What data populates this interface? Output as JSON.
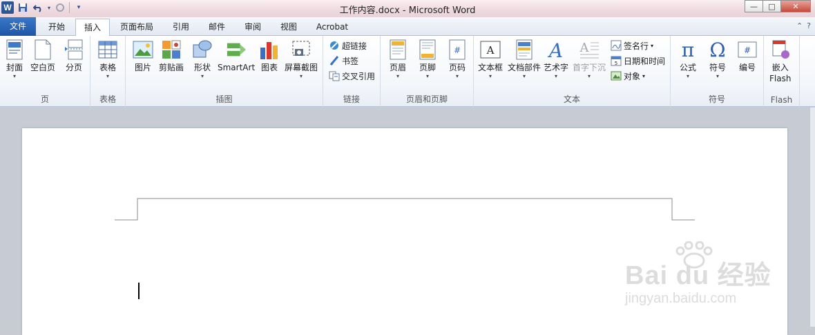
{
  "app": {
    "title": "工作内容.docx  -  Microsoft Word",
    "logo_letter": "W"
  },
  "quick_access": {
    "icons": [
      "save-icon",
      "undo-icon",
      "redo-icon",
      "customize-icon"
    ]
  },
  "window_controls": {
    "minimize": "—",
    "maximize": "□",
    "close": "✕"
  },
  "tabs": [
    {
      "label": "文件"
    },
    {
      "label": "开始"
    },
    {
      "label": "插入"
    },
    {
      "label": "页面布局"
    },
    {
      "label": "引用"
    },
    {
      "label": "邮件"
    },
    {
      "label": "审阅"
    },
    {
      "label": "视图"
    },
    {
      "label": "Acrobat"
    }
  ],
  "ribbon": {
    "groups": {
      "page": {
        "label": "页",
        "buttons": [
          "封面",
          "空白页",
          "分页"
        ]
      },
      "table": {
        "label": "表格",
        "buttons": [
          "表格"
        ]
      },
      "illustrations": {
        "label": "插图",
        "buttons": [
          "图片",
          "剪贴画",
          "形状",
          "SmartArt",
          "图表",
          "屏幕截图"
        ]
      },
      "links": {
        "label": "链接",
        "buttons": [
          "超链接",
          "书签",
          "交叉引用"
        ]
      },
      "header_footer": {
        "label": "页眉和页脚",
        "buttons": [
          "页眉",
          "页脚",
          "页码"
        ]
      },
      "text": {
        "label": "文本",
        "buttons": [
          "文本框",
          "文档部件",
          "艺术字",
          "首字下沉"
        ],
        "small": [
          "签名行",
          "日期和时间",
          "对象"
        ]
      },
      "symbols": {
        "label": "符号",
        "buttons": [
          "公式",
          "符号",
          "编号"
        ]
      },
      "flash": {
        "label": "Flash",
        "button_line1": "嵌入",
        "button_line2": "Flash"
      }
    }
  },
  "watermark": {
    "main": "Bai du 经验",
    "sub": "jingyan.baidu.com"
  },
  "colors": {
    "file_tab": "#2b5797",
    "accent": "#1f56a7"
  }
}
